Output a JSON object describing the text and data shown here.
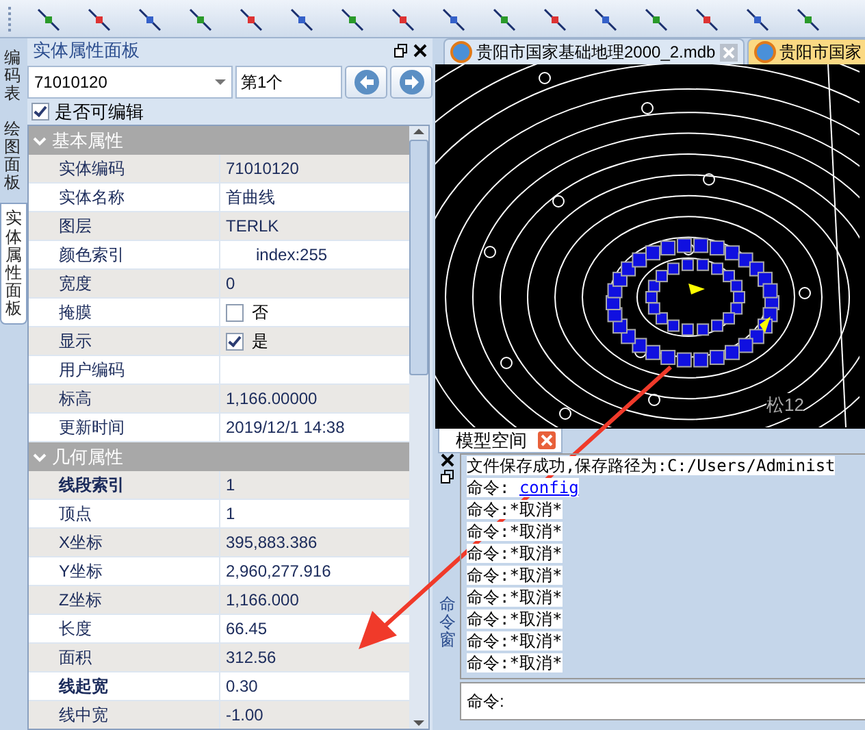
{
  "side_tabs": [
    {
      "label": "编码表",
      "selected": false
    },
    {
      "label": "绘图面板",
      "selected": false
    },
    {
      "label": "实体属性面板",
      "selected": true
    }
  ],
  "panel": {
    "title": "实体属性面板",
    "code_select": "71010120",
    "index_field": "第1个",
    "editable": {
      "label": "是否可编辑",
      "checked": true
    },
    "groups": [
      {
        "title": "基本属性",
        "expanded": true,
        "rows": [
          {
            "kind": "text",
            "name": "实体编码",
            "value": "71010120",
            "bold": false
          },
          {
            "kind": "text",
            "name": "实体名称",
            "value": "首曲线",
            "bold": false
          },
          {
            "kind": "text",
            "name": "图层",
            "value": "TERLK",
            "bold": false
          },
          {
            "kind": "color",
            "name": "颜色索引",
            "value": "index:255",
            "bold": false
          },
          {
            "kind": "text",
            "name": "宽度",
            "value": "0",
            "bold": false
          },
          {
            "kind": "checkbox",
            "name": "掩膜",
            "value": "否",
            "checked": false,
            "bold": false
          },
          {
            "kind": "checkbox",
            "name": "显示",
            "value": "是",
            "checked": true,
            "bold": false
          },
          {
            "kind": "text",
            "name": "用户编码",
            "bold": false
          },
          {
            "kind": "text",
            "name": "标高",
            "value": "1,166.00000",
            "bold": false
          },
          {
            "kind": "text",
            "name": "更新时间",
            "value": "2019/12/1 14:38",
            "bold": false
          }
        ]
      },
      {
        "title": "几何属性",
        "expanded": true,
        "rows": [
          {
            "kind": "text",
            "name": "线段索引",
            "value": "1",
            "bold": true
          },
          {
            "kind": "text",
            "name": "顶点",
            "value": "1",
            "bold": false
          },
          {
            "kind": "text",
            "name": "X坐标",
            "value": "395,883.386",
            "bold": false
          },
          {
            "kind": "text",
            "name": "Y坐标",
            "value": "2,960,277.916",
            "bold": false
          },
          {
            "kind": "text",
            "name": "Z坐标",
            "value": "1,166.000",
            "bold": false
          },
          {
            "kind": "text",
            "name": "长度",
            "value": "66.45",
            "bold": false
          },
          {
            "kind": "text",
            "name": "面积",
            "value": "312.56",
            "bold": false
          },
          {
            "kind": "text",
            "name": "线起宽",
            "value": "0.30",
            "bold": true
          },
          {
            "kind": "text",
            "name": "线中宽",
            "value": "-1.00",
            "bold": false
          }
        ]
      }
    ]
  },
  "doc_tabs": [
    {
      "label": "贵阳市国家基础地理2000_2.mdb",
      "selected": false
    },
    {
      "label": "贵阳市国家",
      "selected": true
    }
  ],
  "map": {
    "label": "松12"
  },
  "layout_tabs": [
    {
      "label": "模型空间",
      "selected": true
    }
  ],
  "command": {
    "side_label": "命令窗",
    "lines": [
      {
        "kind": "text",
        "text": "文件保存成功,保存路径为:C:/Users/Administ"
      },
      {
        "kind": "link",
        "prefix": "命令: ",
        "text": "config"
      },
      {
        "kind": "text",
        "text": "命令:*取消*"
      },
      {
        "kind": "text",
        "text": "命令:*取消*"
      },
      {
        "kind": "text",
        "text": "命令:*取消*"
      },
      {
        "kind": "text",
        "text": "命令:*取消*"
      },
      {
        "kind": "text",
        "text": "命令:*取消*"
      },
      {
        "kind": "text",
        "text": "命令:*取消*"
      },
      {
        "kind": "text",
        "text": "命令:*取消*"
      },
      {
        "kind": "text",
        "text": "命令:*取消*"
      }
    ],
    "prompt": "命令:"
  }
}
